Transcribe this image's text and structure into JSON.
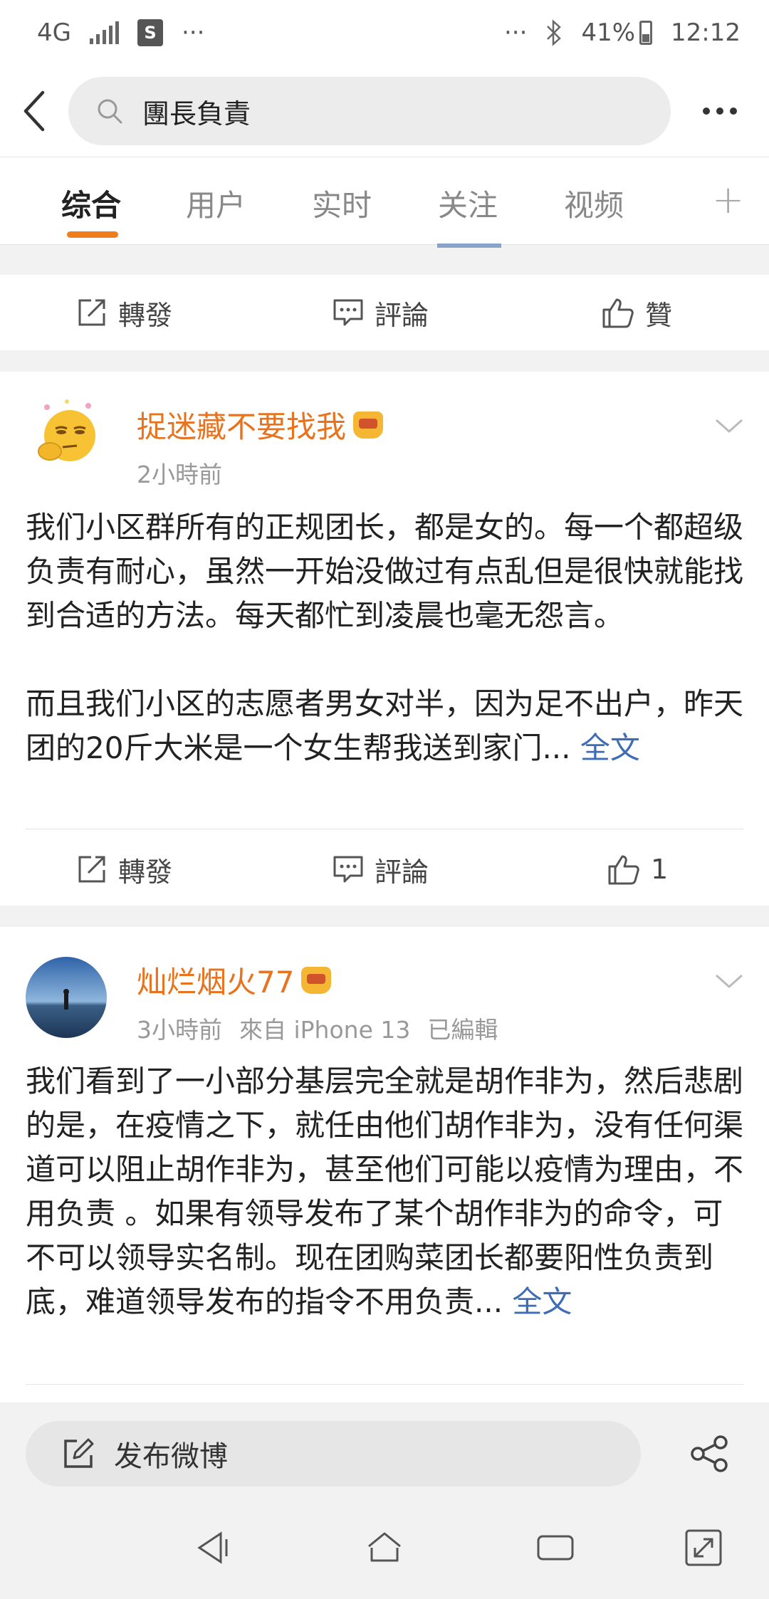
{
  "status_bar": {
    "network": "4G",
    "dots": "···",
    "battery": "41%",
    "time": "12:12"
  },
  "search": {
    "query": "團長負責"
  },
  "tabs": [
    {
      "label": "综合",
      "active": true
    },
    {
      "label": "用户",
      "active": false
    },
    {
      "label": "实时",
      "active": false
    },
    {
      "label": "关注",
      "active": false
    },
    {
      "label": "视频",
      "active": false
    }
  ],
  "top_actions": {
    "repost": "轉發",
    "comment": "評論",
    "like": "贊"
  },
  "posts": [
    {
      "username": "捉迷藏不要找我",
      "time": "2小時前",
      "body_p1": "我们小区群所有的正规团长，都是女的。每一个都超级负责有耐心，虽然一开始没做过有点乱但是很快就能找到合适的方法。每天都忙到凌晨也毫无怨言。",
      "body_p2": "而且我们小区的志愿者男女对半，因为足不出户，昨天团的20斤大米是一个女生帮我送到家门...",
      "more": "全文",
      "repost": "轉發",
      "comment": "評論",
      "likes": "1"
    },
    {
      "username": "灿烂烟火77",
      "time": "3小時前",
      "source": "來自 iPhone 13",
      "edited": "已編輯",
      "body": "我们看到了一小部分基层完全就是胡作非为，然后悲剧的是，在疫情之下，就任由他们胡作非为，没有任何渠道可以阻止胡作非为，甚至他们可能以疫情为理由，不用负责 。如果有领导发布了某个胡作非为的命令，可不可以领导实名制。现在团购菜团长都要阳性负责到底，难道领导发布的指令不用负责...",
      "more": "全文"
    }
  ],
  "compose": {
    "label": "发布微博"
  },
  "colors": {
    "accent": "#f07c1c",
    "username": "#e8731e",
    "link": "#3e6cb5"
  }
}
